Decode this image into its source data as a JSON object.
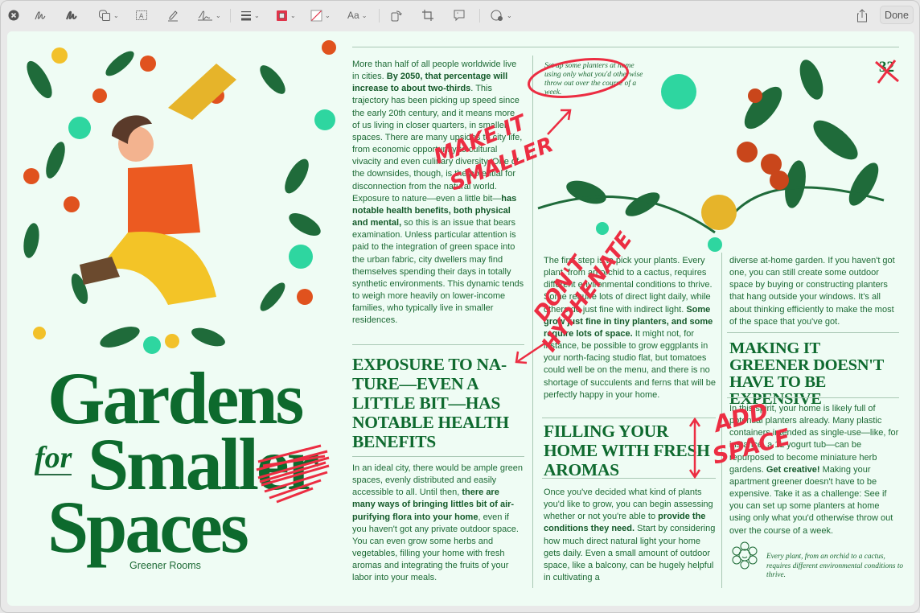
{
  "toolbar": {
    "tools": [
      "close-window",
      "sketch",
      "draw",
      "shapes",
      "text-box",
      "highlight",
      "sign",
      "line-style",
      "border-color",
      "fill-color",
      "text-style",
      "rotate",
      "crop",
      "note",
      "markup-accessibility"
    ],
    "font_style_label": "Aa",
    "done_label": "Done",
    "border_color": "#e0344a"
  },
  "colors": {
    "accent_green": "#0f6a2f",
    "annotation_red": "#ec2d42",
    "page_bg": "#effcf4"
  },
  "document": {
    "title_line1": "Gardens",
    "title_for": "for",
    "title_line2": "Smaller",
    "title_line3": "Spaces",
    "subtitle": "Greener Rooms",
    "page_number": "32",
    "pull_quote": "Set up some planters at home using only what you'd otherwise throw out over the course of a week.",
    "caption": "Every plant, from an orchid to a cactus, requires different environmental conditions to thrive.",
    "col1_p1": [
      {
        "t": "More than half of all people worldwide live in cities. "
      },
      {
        "t": "By 2050, that percentage will increase to about two-thirds",
        "b": true
      },
      {
        "t": ". This trajectory has been picking up speed since the early 20th century, and it means more of us living in closer quarters, in smaller spaces. There are many upsides to city life, from economic opportunity to cultural vivacity and even culinary diversity. One of the downsides, though, is the potential for disconnection from the natural world. Exposure to nature—even a little bit—"
      },
      {
        "t": "has notable health benefits, both physical and mental,",
        "b": true
      },
      {
        "t": " so this is an issue that bears examination. Unless particular attention is paid to the integration of green space into the urban fabric, city dwellers may find themselves spending their days in totally synthetic environments. This dynamic tends to weigh more heavily on lower-income families, who typically live in smaller residences."
      }
    ],
    "heading1": "Exposure to na-ture—even a little bit—has notable health benefits",
    "col1_p2": [
      {
        "t": "In an ideal city, there would be ample green spaces, evenly distributed and easily accessible to all. Until then, "
      },
      {
        "t": "there are many ways of bringing littles bit of air-purifying flora into your home",
        "b": true
      },
      {
        "t": ", even if you haven't got any private outdoor space. You can even grow some herbs and vegetables, filling your home with fresh aromas and integrating the fruits of your labor into your meals."
      }
    ],
    "col2_p1": [
      {
        "t": "The first step is to pick your plants. Every plant, from an orchid to a cactus, requires different environmental conditions to thrive. Some require lots of direct light daily, while others do just fine with indirect light. "
      },
      {
        "t": "Some grow just fine in tiny planters, and some require lots of space.",
        "b": true
      },
      {
        "t": " It might not, for instance, be possible to grow eggplants in your north-facing studio flat, but tomatoes could well be on the menu, and there is no shortage of succulents and ferns that will be perfectly happy in your home."
      }
    ],
    "heading2": "Filling your home with fresh aromas",
    "col2_p2": [
      {
        "t": "Once you've decided what kind of plants you'd like to grow, you can begin assessing whether or not you're able to "
      },
      {
        "t": "provide the conditions they need.",
        "b": true
      },
      {
        "t": " Start by considering how much direct natural light your home gets daily. Even a small amount of outdoor space, like a balcony, can be hugely helpful in cultivating a"
      }
    ],
    "col3_p1": [
      {
        "t": "diverse at-home garden. If you haven't got one, you can still create some outdoor space by buying or constructing planters that hang outside your windows. It's all about thinking efficiently to make the most of the space that you've got."
      }
    ],
    "heading3": "Making it greener doesn't have to be expensive",
    "col3_p2": [
      {
        "t": "In this spirit, your home is likely full of potential planters already. Many plastic containers intended as single-use—like, for instance, a 1L yogurt tub—can be repurposed to become miniature herb gardens. "
      },
      {
        "t": "Get creative!",
        "b": true
      },
      {
        "t": " Making your apartment greener doesn't have to be expensive. Take it as a challenge: See if you can set up some planters at home using only what you'd otherwise throw out over the course of a week."
      }
    ]
  },
  "annotations": {
    "make_it": "MAKE IT",
    "smaller": "SMALLER",
    "dont": "DON'T",
    "hyphenate": "HYPHENATE",
    "add": "ADD",
    "space": "SPACE"
  }
}
